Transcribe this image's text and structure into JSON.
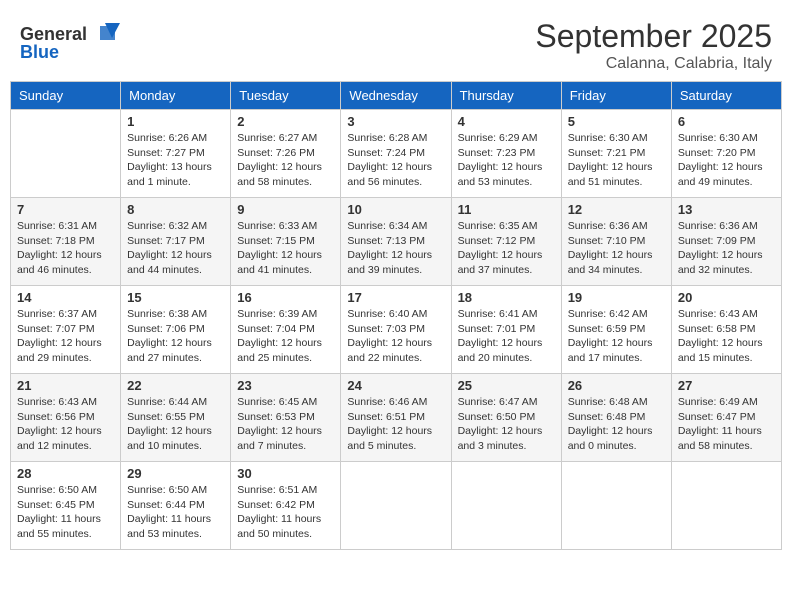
{
  "header": {
    "logo_general": "General",
    "logo_blue": "Blue",
    "month": "September 2025",
    "location": "Calanna, Calabria, Italy"
  },
  "days_of_week": [
    "Sunday",
    "Monday",
    "Tuesday",
    "Wednesday",
    "Thursday",
    "Friday",
    "Saturday"
  ],
  "weeks": [
    [
      {
        "day": "",
        "sunrise": "",
        "sunset": "",
        "daylight": ""
      },
      {
        "day": "1",
        "sunrise": "Sunrise: 6:26 AM",
        "sunset": "Sunset: 7:27 PM",
        "daylight": "Daylight: 13 hours and 1 minute."
      },
      {
        "day": "2",
        "sunrise": "Sunrise: 6:27 AM",
        "sunset": "Sunset: 7:26 PM",
        "daylight": "Daylight: 12 hours and 58 minutes."
      },
      {
        "day": "3",
        "sunrise": "Sunrise: 6:28 AM",
        "sunset": "Sunset: 7:24 PM",
        "daylight": "Daylight: 12 hours and 56 minutes."
      },
      {
        "day": "4",
        "sunrise": "Sunrise: 6:29 AM",
        "sunset": "Sunset: 7:23 PM",
        "daylight": "Daylight: 12 hours and 53 minutes."
      },
      {
        "day": "5",
        "sunrise": "Sunrise: 6:30 AM",
        "sunset": "Sunset: 7:21 PM",
        "daylight": "Daylight: 12 hours and 51 minutes."
      },
      {
        "day": "6",
        "sunrise": "Sunrise: 6:30 AM",
        "sunset": "Sunset: 7:20 PM",
        "daylight": "Daylight: 12 hours and 49 minutes."
      }
    ],
    [
      {
        "day": "7",
        "sunrise": "Sunrise: 6:31 AM",
        "sunset": "Sunset: 7:18 PM",
        "daylight": "Daylight: 12 hours and 46 minutes."
      },
      {
        "day": "8",
        "sunrise": "Sunrise: 6:32 AM",
        "sunset": "Sunset: 7:17 PM",
        "daylight": "Daylight: 12 hours and 44 minutes."
      },
      {
        "day": "9",
        "sunrise": "Sunrise: 6:33 AM",
        "sunset": "Sunset: 7:15 PM",
        "daylight": "Daylight: 12 hours and 41 minutes."
      },
      {
        "day": "10",
        "sunrise": "Sunrise: 6:34 AM",
        "sunset": "Sunset: 7:13 PM",
        "daylight": "Daylight: 12 hours and 39 minutes."
      },
      {
        "day": "11",
        "sunrise": "Sunrise: 6:35 AM",
        "sunset": "Sunset: 7:12 PM",
        "daylight": "Daylight: 12 hours and 37 minutes."
      },
      {
        "day": "12",
        "sunrise": "Sunrise: 6:36 AM",
        "sunset": "Sunset: 7:10 PM",
        "daylight": "Daylight: 12 hours and 34 minutes."
      },
      {
        "day": "13",
        "sunrise": "Sunrise: 6:36 AM",
        "sunset": "Sunset: 7:09 PM",
        "daylight": "Daylight: 12 hours and 32 minutes."
      }
    ],
    [
      {
        "day": "14",
        "sunrise": "Sunrise: 6:37 AM",
        "sunset": "Sunset: 7:07 PM",
        "daylight": "Daylight: 12 hours and 29 minutes."
      },
      {
        "day": "15",
        "sunrise": "Sunrise: 6:38 AM",
        "sunset": "Sunset: 7:06 PM",
        "daylight": "Daylight: 12 hours and 27 minutes."
      },
      {
        "day": "16",
        "sunrise": "Sunrise: 6:39 AM",
        "sunset": "Sunset: 7:04 PM",
        "daylight": "Daylight: 12 hours and 25 minutes."
      },
      {
        "day": "17",
        "sunrise": "Sunrise: 6:40 AM",
        "sunset": "Sunset: 7:03 PM",
        "daylight": "Daylight: 12 hours and 22 minutes."
      },
      {
        "day": "18",
        "sunrise": "Sunrise: 6:41 AM",
        "sunset": "Sunset: 7:01 PM",
        "daylight": "Daylight: 12 hours and 20 minutes."
      },
      {
        "day": "19",
        "sunrise": "Sunrise: 6:42 AM",
        "sunset": "Sunset: 6:59 PM",
        "daylight": "Daylight: 12 hours and 17 minutes."
      },
      {
        "day": "20",
        "sunrise": "Sunrise: 6:43 AM",
        "sunset": "Sunset: 6:58 PM",
        "daylight": "Daylight: 12 hours and 15 minutes."
      }
    ],
    [
      {
        "day": "21",
        "sunrise": "Sunrise: 6:43 AM",
        "sunset": "Sunset: 6:56 PM",
        "daylight": "Daylight: 12 hours and 12 minutes."
      },
      {
        "day": "22",
        "sunrise": "Sunrise: 6:44 AM",
        "sunset": "Sunset: 6:55 PM",
        "daylight": "Daylight: 12 hours and 10 minutes."
      },
      {
        "day": "23",
        "sunrise": "Sunrise: 6:45 AM",
        "sunset": "Sunset: 6:53 PM",
        "daylight": "Daylight: 12 hours and 7 minutes."
      },
      {
        "day": "24",
        "sunrise": "Sunrise: 6:46 AM",
        "sunset": "Sunset: 6:51 PM",
        "daylight": "Daylight: 12 hours and 5 minutes."
      },
      {
        "day": "25",
        "sunrise": "Sunrise: 6:47 AM",
        "sunset": "Sunset: 6:50 PM",
        "daylight": "Daylight: 12 hours and 3 minutes."
      },
      {
        "day": "26",
        "sunrise": "Sunrise: 6:48 AM",
        "sunset": "Sunset: 6:48 PM",
        "daylight": "Daylight: 12 hours and 0 minutes."
      },
      {
        "day": "27",
        "sunrise": "Sunrise: 6:49 AM",
        "sunset": "Sunset: 6:47 PM",
        "daylight": "Daylight: 11 hours and 58 minutes."
      }
    ],
    [
      {
        "day": "28",
        "sunrise": "Sunrise: 6:50 AM",
        "sunset": "Sunset: 6:45 PM",
        "daylight": "Daylight: 11 hours and 55 minutes."
      },
      {
        "day": "29",
        "sunrise": "Sunrise: 6:50 AM",
        "sunset": "Sunset: 6:44 PM",
        "daylight": "Daylight: 11 hours and 53 minutes."
      },
      {
        "day": "30",
        "sunrise": "Sunrise: 6:51 AM",
        "sunset": "Sunset: 6:42 PM",
        "daylight": "Daylight: 11 hours and 50 minutes."
      },
      {
        "day": "",
        "sunrise": "",
        "sunset": "",
        "daylight": ""
      },
      {
        "day": "",
        "sunrise": "",
        "sunset": "",
        "daylight": ""
      },
      {
        "day": "",
        "sunrise": "",
        "sunset": "",
        "daylight": ""
      },
      {
        "day": "",
        "sunrise": "",
        "sunset": "",
        "daylight": ""
      }
    ]
  ]
}
